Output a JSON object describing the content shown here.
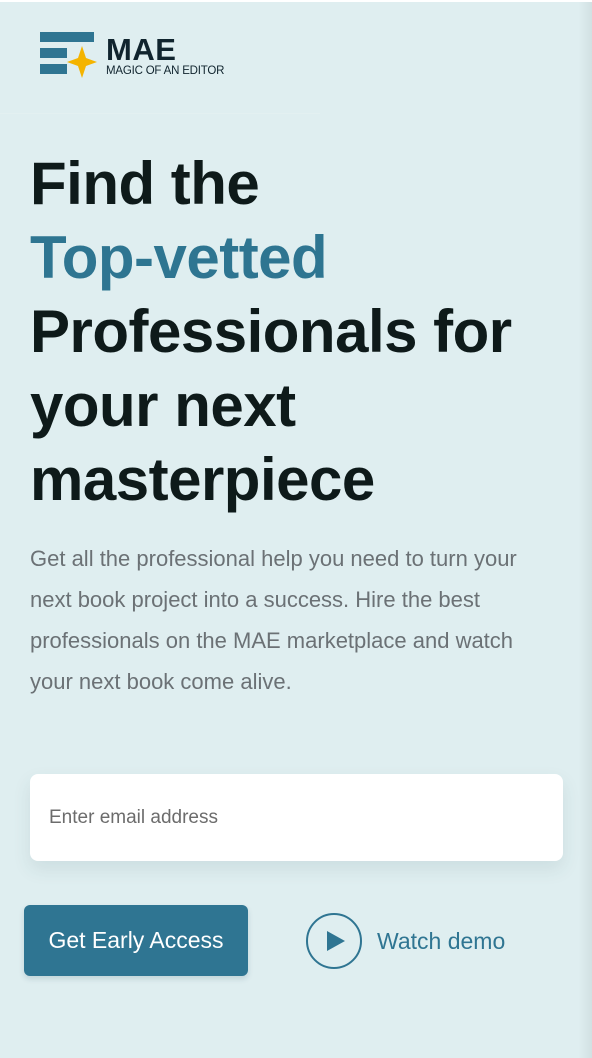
{
  "brand": {
    "name": "MAE",
    "tagline": "MAGIC OF AN EDITOR",
    "colors": {
      "primary": "#2f7592",
      "accent_star": "#f4b400",
      "background": "#dfeef0",
      "text_dark": "#0e1a1a"
    }
  },
  "hero": {
    "headline": {
      "line1": "Find the",
      "line2_accent": "Top-vetted",
      "line3": "Professionals for",
      "line4": "your next",
      "line5": "masterpiece"
    },
    "subtitle": "Get all the professional help you need to turn your next book project into a success. Hire the best professionals on the MAE marketplace and watch your next book come alive."
  },
  "signup": {
    "email_placeholder": "Enter email address",
    "email_value": "",
    "cta_label": "Get Early Access",
    "watch_demo_label": "Watch demo",
    "watch_demo_icon": "play-icon"
  }
}
